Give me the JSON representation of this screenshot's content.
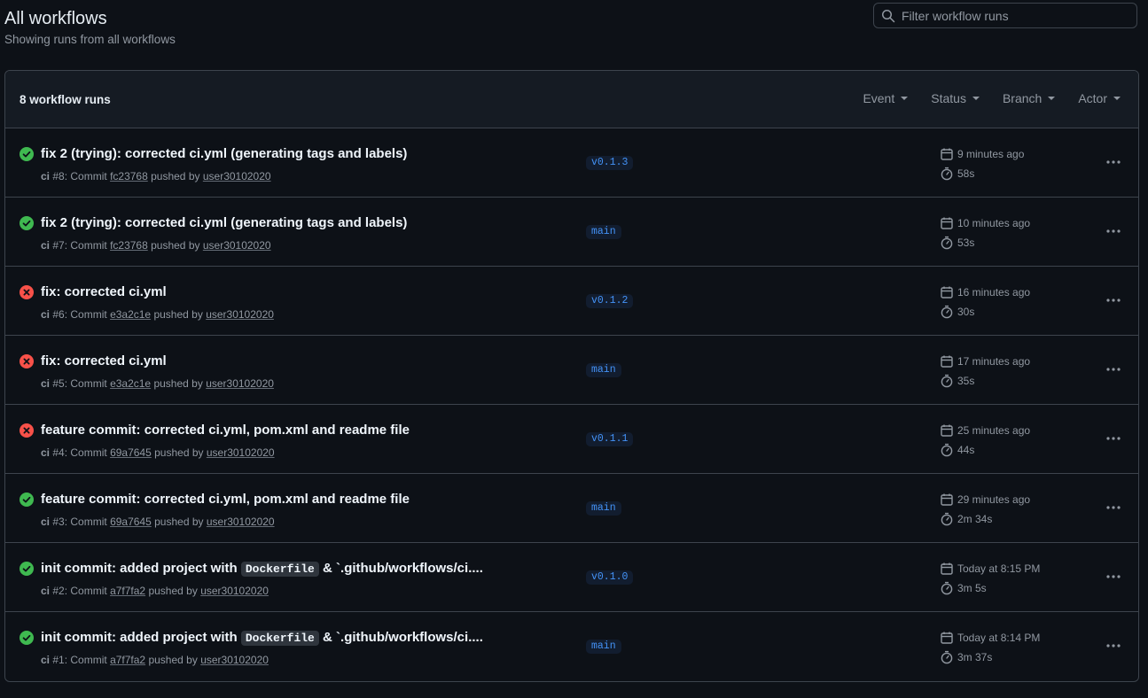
{
  "header": {
    "title": "All workflows",
    "subtitle": "Showing runs from all workflows"
  },
  "search": {
    "placeholder": "Filter workflow runs",
    "value": ""
  },
  "list": {
    "count_label": "8 workflow runs",
    "filters": [
      "Event",
      "Status",
      "Branch",
      "Actor"
    ]
  },
  "colors": {
    "success": "#3fb950",
    "failure": "#f85149",
    "link": "#4493f8"
  },
  "runs": [
    {
      "status": "success",
      "title": "fix 2 (trying): corrected ci.yml (generating tags and labels)",
      "workflow": "ci",
      "number": "#8",
      "commit_label": ": Commit",
      "commit": "fc23768",
      "pushed_by": "pushed by",
      "user": "user30102020",
      "branch": "v0.1.3",
      "time": "9 minutes ago",
      "duration": "58s"
    },
    {
      "status": "success",
      "title": "fix 2 (trying): corrected ci.yml (generating tags and labels)",
      "workflow": "ci",
      "number": "#7",
      "commit_label": ": Commit",
      "commit": "fc23768",
      "pushed_by": "pushed by",
      "user": "user30102020",
      "branch": "main",
      "time": "10 minutes ago",
      "duration": "53s"
    },
    {
      "status": "failure",
      "title": "fix: corrected ci.yml",
      "workflow": "ci",
      "number": "#6",
      "commit_label": ": Commit",
      "commit": "e3a2c1e",
      "pushed_by": "pushed by",
      "user": "user30102020",
      "branch": "v0.1.2",
      "time": "16 minutes ago",
      "duration": "30s"
    },
    {
      "status": "failure",
      "title": "fix: corrected ci.yml",
      "workflow": "ci",
      "number": "#5",
      "commit_label": ": Commit",
      "commit": "e3a2c1e",
      "pushed_by": "pushed by",
      "user": "user30102020",
      "branch": "main",
      "time": "17 minutes ago",
      "duration": "35s"
    },
    {
      "status": "failure",
      "title": "feature commit: corrected ci.yml, pom.xml and readme file",
      "workflow": "ci",
      "number": "#4",
      "commit_label": ": Commit",
      "commit": "69a7645",
      "pushed_by": "pushed by",
      "user": "user30102020",
      "branch": "v0.1.1",
      "time": "25 minutes ago",
      "duration": "44s"
    },
    {
      "status": "success",
      "title": "feature commit: corrected ci.yml, pom.xml and readme file",
      "workflow": "ci",
      "number": "#3",
      "commit_label": ": Commit",
      "commit": "69a7645",
      "pushed_by": "pushed by",
      "user": "user30102020",
      "branch": "main",
      "time": "29 minutes ago",
      "duration": "2m 34s"
    },
    {
      "status": "success",
      "title_parts": [
        "init commit: added project with ",
        "Dockerfile",
        " & `.github/workflows/ci...."
      ],
      "workflow": "ci",
      "number": "#2",
      "commit_label": ": Commit",
      "commit": "a7f7fa2",
      "pushed_by": "pushed by",
      "user": "user30102020",
      "branch": "v0.1.0",
      "time": "Today at 8:15 PM",
      "duration": "3m 5s"
    },
    {
      "status": "success",
      "title_parts": [
        "init commit: added project with ",
        "Dockerfile",
        " & `.github/workflows/ci...."
      ],
      "workflow": "ci",
      "number": "#1",
      "commit_label": ": Commit",
      "commit": "a7f7fa2",
      "pushed_by": "pushed by",
      "user": "user30102020",
      "branch": "main",
      "time": "Today at 8:14 PM",
      "duration": "3m 37s"
    }
  ]
}
